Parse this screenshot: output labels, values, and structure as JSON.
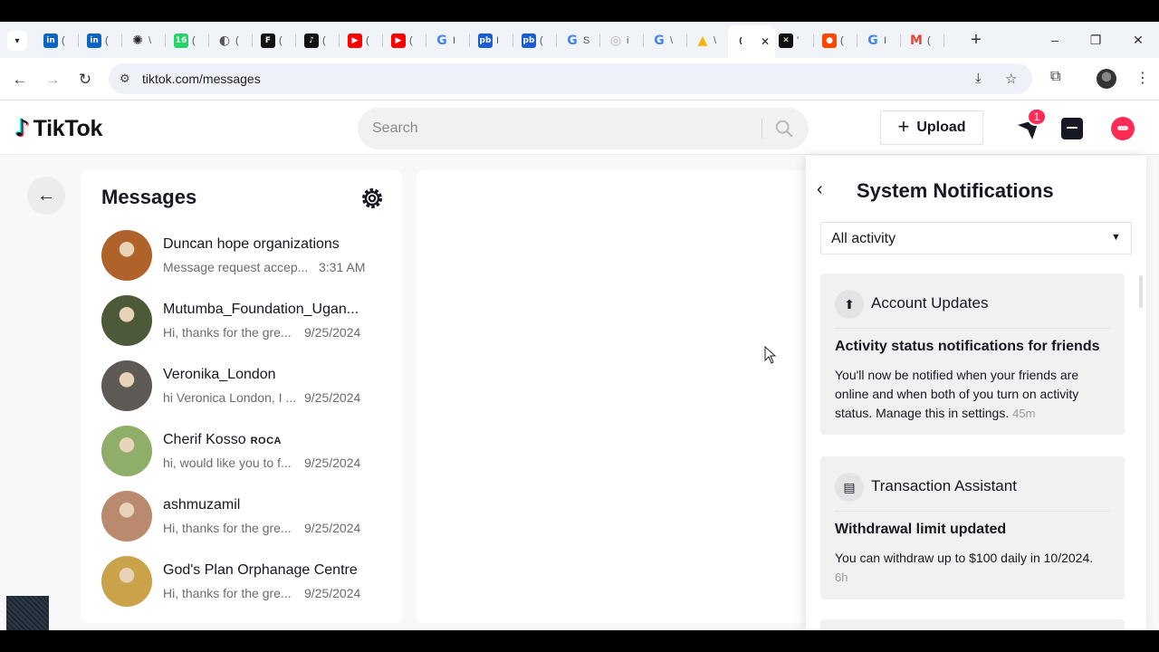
{
  "browser": {
    "tabs": [
      {
        "icon": "linkedin-icon",
        "glyph": "in",
        "color": "#0a66c2",
        "title": "("
      },
      {
        "icon": "linkedin-icon",
        "glyph": "in",
        "color": "#0a66c2",
        "title": "("
      },
      {
        "icon": "chatgpt-icon",
        "glyph": "✺",
        "color": "#222222",
        "title": "\\"
      },
      {
        "icon": "whatsapp-icon",
        "glyph": "16",
        "color": "#25d366",
        "title": "("
      },
      {
        "icon": "globe-icon",
        "glyph": "◐",
        "color": "#555555",
        "title": "("
      },
      {
        "icon": "f-icon",
        "glyph": "F",
        "color": "#111111",
        "title": "("
      },
      {
        "icon": "tiktok-icon",
        "glyph": "♪",
        "color": "#111111",
        "title": "("
      },
      {
        "icon": "youtube-icon",
        "glyph": "▶",
        "color": "#ff0000",
        "title": "("
      },
      {
        "icon": "youtube-icon",
        "glyph": "▶",
        "color": "#ff0000",
        "title": "("
      },
      {
        "icon": "google-icon",
        "glyph": "G",
        "color": "#4285f4",
        "title": "I"
      },
      {
        "icon": "pb-icon",
        "glyph": "pb",
        "color": "#1a5bd6",
        "title": "I"
      },
      {
        "icon": "pb-icon",
        "glyph": "pb",
        "color": "#1a5bd6",
        "title": "("
      },
      {
        "icon": "google-icon",
        "glyph": "G",
        "color": "#4285f4",
        "title": "S"
      },
      {
        "icon": "loading-icon",
        "glyph": "◎",
        "color": "#bbbbbb",
        "title": "i"
      },
      {
        "icon": "google-icon",
        "glyph": "G",
        "color": "#4285f4",
        "title": "\\"
      },
      {
        "icon": "drive-icon",
        "glyph": "▲",
        "color": "#f4b400",
        "title": "\\"
      },
      {
        "icon": "active-tab-icon",
        "glyph": "(",
        "color": "#222222",
        "title": "",
        "active": true
      },
      {
        "icon": "capcut-icon",
        "glyph": "✕",
        "color": "#111111",
        "title": "'"
      },
      {
        "icon": "reddit-icon",
        "glyph": "●",
        "color": "#ff4500",
        "title": "("
      },
      {
        "icon": "google-icon",
        "glyph": "G",
        "color": "#4285f4",
        "title": "I"
      },
      {
        "icon": "gmail-icon",
        "glyph": "M",
        "color": "#ea4335",
        "title": "("
      }
    ],
    "tab_close": "✕",
    "new_tab": "+",
    "url": "tiktok.com/messages"
  },
  "header": {
    "logo_text": "TikTok",
    "search_placeholder": "Search",
    "upload_label": "Upload",
    "inbox_badge": "1"
  },
  "messages": {
    "title": "Messages",
    "conversations": [
      {
        "name": "Duncan hope organizations",
        "preview": "Message request accep...",
        "time": "3:31 AM",
        "color": "#b0622b"
      },
      {
        "name": "Mutumba_Foundation_Ugan...",
        "preview": "Hi, thanks for the gre...",
        "time": "9/25/2024",
        "color": "#4c5a3a"
      },
      {
        "name": "Veronika_London",
        "preview": "hi Veronica London, I ...",
        "time": "9/25/2024",
        "color": "#5d5a55"
      },
      {
        "name": "Cherif Kosso",
        "name_suffix": "ROCA",
        "preview": "hi, would like you to f...",
        "time": "9/25/2024",
        "color": "#8fae6a"
      },
      {
        "name": "ashmuzamil",
        "preview": "Hi, thanks for the gre...",
        "time": "9/25/2024",
        "color": "#b98a6d"
      },
      {
        "name": "God's Plan Orphanage Centre",
        "preview": "Hi, thanks for the gre...",
        "time": "9/25/2024",
        "color": "#c9a24a"
      }
    ]
  },
  "notifications": {
    "title": "System Notifications",
    "filter_value": "All activity",
    "cards": [
      {
        "category": "Account Updates",
        "category_icon": "upload-arrow-icon",
        "title": "Activity status notifications for friends",
        "body": "You'll now be notified when your friends are online and when both of you turn on activity status. Manage this in settings.",
        "age": "45m"
      },
      {
        "category": "Transaction Assistant",
        "category_icon": "receipt-icon",
        "title": "Withdrawal limit updated",
        "body": "You can withdraw up to $100 daily in 10/2024.",
        "age": "6h"
      }
    ]
  },
  "colors": {
    "brand_red": "#fe2c55",
    "brand_cyan": "#25f4ee",
    "text_primary": "#161823",
    "text_secondary": "#6b6c72"
  }
}
